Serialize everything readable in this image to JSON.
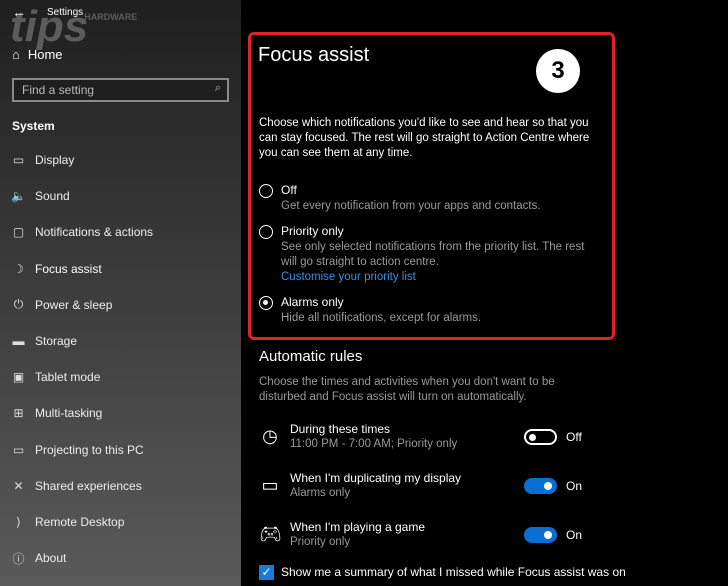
{
  "watermark": {
    "text": "tips",
    "small": "HARDWARE"
  },
  "window": {
    "title": "Settings",
    "back_icon": "arrow-left"
  },
  "sidebar": {
    "home": "Home",
    "search_placeholder": "Find a setting",
    "section": "System",
    "items": [
      {
        "label": "Display",
        "icon": "▭"
      },
      {
        "label": "Sound",
        "icon": "🔈"
      },
      {
        "label": "Notifications & actions",
        "icon": "▢"
      },
      {
        "label": "Focus assist",
        "icon": "☽"
      },
      {
        "label": "Power & sleep",
        "icon": "⏻"
      },
      {
        "label": "Storage",
        "icon": "▬"
      },
      {
        "label": "Tablet mode",
        "icon": "▣"
      },
      {
        "label": "Multi-tasking",
        "icon": "⊞"
      },
      {
        "label": "Projecting to this PC",
        "icon": "▭"
      },
      {
        "label": "Shared experiences",
        "icon": "✕"
      },
      {
        "label": "Remote Desktop",
        "icon": "⟩"
      },
      {
        "label": "About",
        "icon": "ⓘ"
      }
    ]
  },
  "main": {
    "title": "Focus assist",
    "step": "3",
    "description": "Choose which notifications you'd like to see and hear so that you can stay focused. The rest will go straight to Action Centre where you can see them at any time.",
    "options": [
      {
        "label": "Off",
        "desc": "Get every notification from your apps and contacts.",
        "selected": false
      },
      {
        "label": "Priority only",
        "desc": "See only selected notifications from the priority list. The rest will go straight to action centre.",
        "link": "Customise your priority list",
        "selected": false
      },
      {
        "label": "Alarms only",
        "desc": "Hide all notifications, except for alarms.",
        "selected": true
      }
    ],
    "rules_title": "Automatic rules",
    "rules_desc": "Choose the times and activities when you don't want to be disturbed and Focus assist will turn on automatically.",
    "rules": [
      {
        "title": "During these times",
        "sub": "11:00 PM - 7:00 AM; Priority only",
        "state": "Off",
        "icon": "clock"
      },
      {
        "title": "When I'm duplicating my display",
        "sub": "Alarms only",
        "state": "On",
        "icon": "monitor"
      },
      {
        "title": "When I'm playing a game",
        "sub": "Priority only",
        "state": "On",
        "icon": "gamepad"
      }
    ],
    "summary_checkbox": "Show me a summary of what I missed while Focus assist was on",
    "accent": "#0a6fd4",
    "highlight": "#e0202a"
  }
}
